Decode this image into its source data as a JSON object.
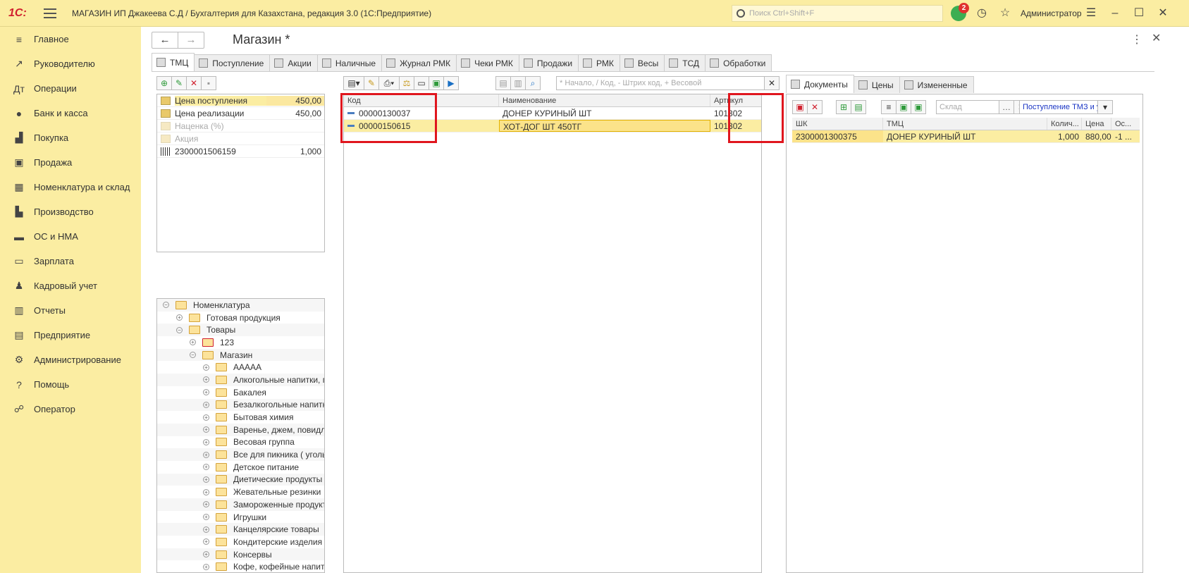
{
  "app": {
    "logo": "1С:",
    "title": "МАГАЗИН ИП Джакеева С.Д / Бухгалтерия для Казахстана, редакция 3.0  (1С:Предприятие)",
    "search_placeholder": "Поиск Ctrl+Shift+F",
    "notifications_count": "2",
    "user": "Администратор"
  },
  "sidebar": {
    "items": [
      {
        "label": "Главное",
        "icon": "menu-icon"
      },
      {
        "label": "Руководителю",
        "icon": "chart-line-icon"
      },
      {
        "label": "Операции",
        "icon": "ledger-icon"
      },
      {
        "label": "Банк и касса",
        "icon": "coin-icon"
      },
      {
        "label": "Покупка",
        "icon": "cart-icon"
      },
      {
        "label": "Продажа",
        "icon": "bag-icon"
      },
      {
        "label": "Номенклатура и склад",
        "icon": "boxes-icon"
      },
      {
        "label": "Производство",
        "icon": "factory-icon"
      },
      {
        "label": "ОС и НМА",
        "icon": "truck-icon"
      },
      {
        "label": "Зарплата",
        "icon": "wallet-icon"
      },
      {
        "label": "Кадровый учет",
        "icon": "people-icon"
      },
      {
        "label": "Отчеты",
        "icon": "bar-chart-icon"
      },
      {
        "label": "Предприятие",
        "icon": "building-icon"
      },
      {
        "label": "Администрирование",
        "icon": "gear-icon"
      },
      {
        "label": "Помощь",
        "icon": "question-icon"
      },
      {
        "label": "Оператор",
        "icon": "operator-icon"
      }
    ]
  },
  "form": {
    "title": "Магазин *",
    "tabs": [
      "ТМЦ",
      "Поступление",
      "Акции",
      "Наличные",
      "Журнал РМК",
      "Чеки РМК",
      "Продажи",
      "РМК",
      "Весы",
      "ТСД",
      "Обработки"
    ]
  },
  "prices": {
    "rows": [
      {
        "label": "Цена поступления",
        "value": "450,00"
      },
      {
        "label": "Цена реализации",
        "value": "450,00"
      },
      {
        "label": "Наценка (%)",
        "value": ""
      },
      {
        "label": "Акция",
        "value": ""
      }
    ],
    "barcode": {
      "code": "2300001506159",
      "qty": "1,000"
    }
  },
  "tree": {
    "rows": [
      {
        "label": "Номенклатура"
      },
      {
        "label": "Готовая продукция"
      },
      {
        "label": "Товары"
      },
      {
        "label": "123"
      },
      {
        "label": "Магазин"
      },
      {
        "label": "ААААА"
      },
      {
        "label": "Алкогольные напитки, пиво"
      },
      {
        "label": "Бакалея"
      },
      {
        "label": "Безалкогольные напитки, сок"
      },
      {
        "label": "Бытовая химия"
      },
      {
        "label": "Варенье, джем, повидло, мёд"
      },
      {
        "label": "Весовая группа"
      },
      {
        "label": "Все для пикника ( уголь, манг"
      },
      {
        "label": "Детское питание"
      },
      {
        "label": "Диетические продукты"
      },
      {
        "label": "Жевательные резинки"
      },
      {
        "label": "Замороженные продукты"
      },
      {
        "label": "Игрушки"
      },
      {
        "label": "Канцелярские товары"
      },
      {
        "label": "Кондитерские изделия"
      },
      {
        "label": "Консервы"
      },
      {
        "label": "Кофе, кофейные напитки"
      }
    ]
  },
  "center": {
    "search_placeholder": "* Начало, / Код, - Штрих код, + Весовой",
    "columns": {
      "code": "Код",
      "name": "Наименование",
      "article": "Артикул"
    },
    "rows": [
      {
        "code": "00000130037",
        "name": "ДОНЕР КУРИНЫЙ ШТ",
        "article": "101302"
      },
      {
        "code": "00000150615",
        "name": "ХОТ-ДОГ ШТ 450ТГ",
        "article": "101302"
      }
    ]
  },
  "right": {
    "tabs": [
      "Документы",
      "Цены",
      "Измененные"
    ],
    "warehouse_placeholder": "Склад",
    "doc_type": "Поступление ТМЗ и ус",
    "columns": {
      "barcode": "ШК",
      "item": "ТМЦ",
      "qty": "Колич...",
      "price": "Цена",
      "rest": "Ос..."
    },
    "rows": [
      {
        "barcode": "2300001300375",
        "item": "ДОНЕР КУРИНЫЙ ШТ",
        "qty": "1,000",
        "price": "880,00",
        "rest": "-1 ..."
      }
    ]
  }
}
